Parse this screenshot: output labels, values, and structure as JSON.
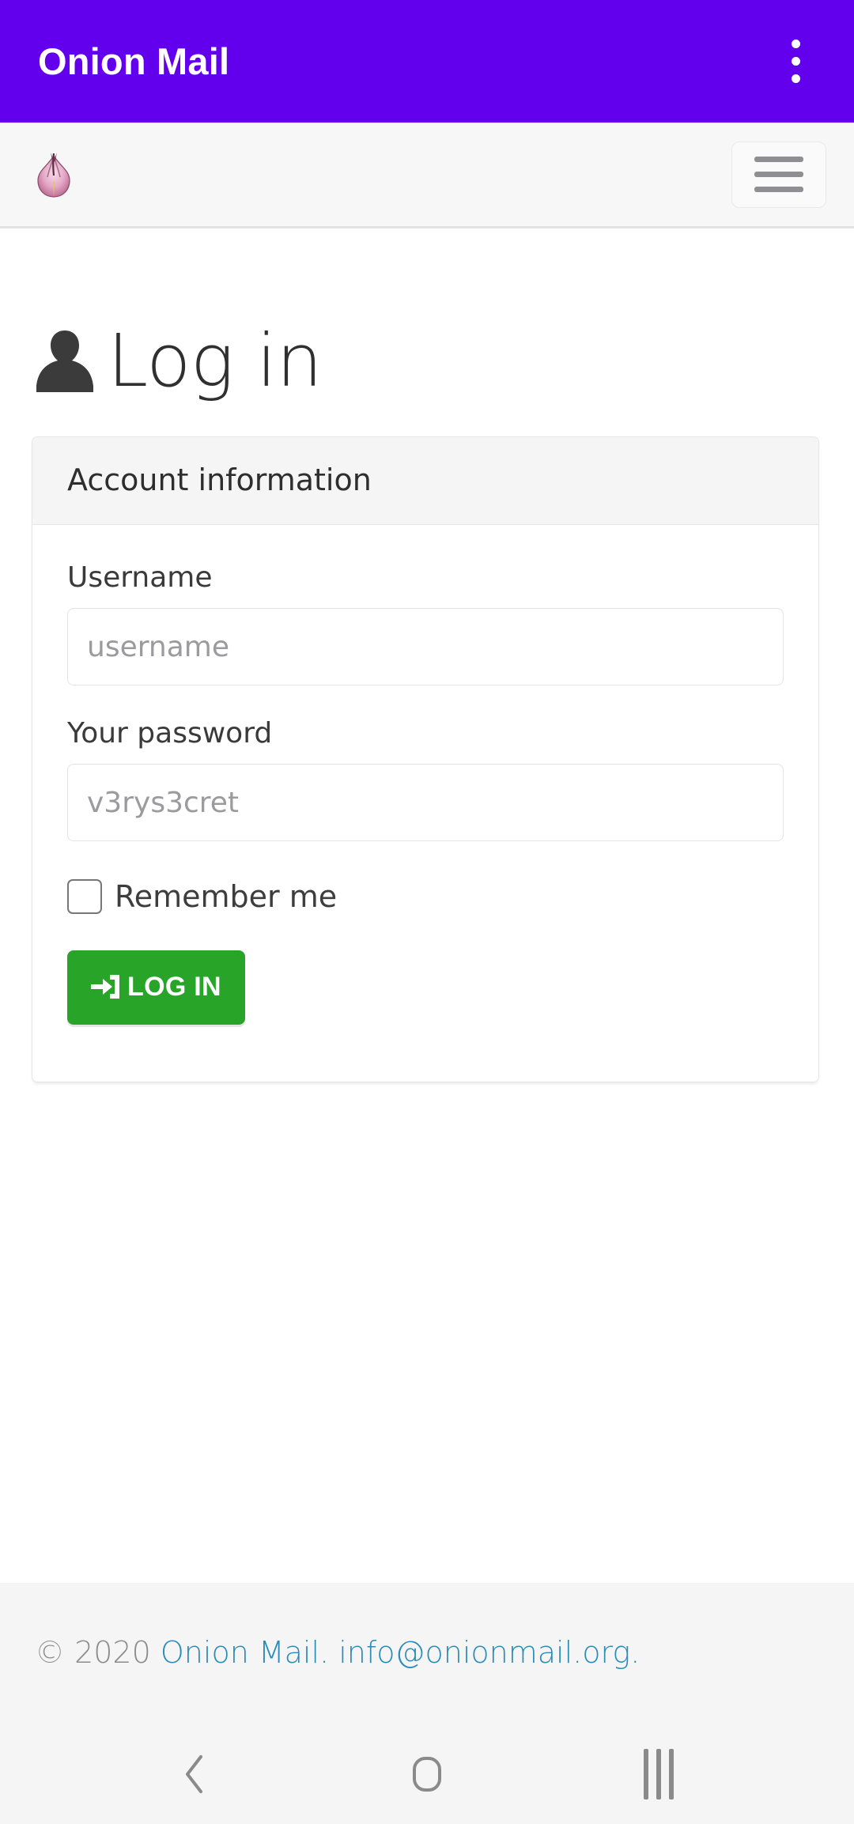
{
  "app_bar": {
    "title": "Onion Mail",
    "overflow_icon": "more-vertical-icon",
    "background_color": "#6200ee"
  },
  "site_nav": {
    "brand_icon": "onion-logo-icon",
    "menu_toggle_icon": "hamburger-icon"
  },
  "page": {
    "heading_icon": "user-silhouette-icon",
    "heading": "Log in"
  },
  "card": {
    "header": "Account information",
    "fields": [
      {
        "label": "Username",
        "placeholder": "username",
        "value": "",
        "name": "username-input"
      },
      {
        "label": "Your password",
        "placeholder": "v3rys3cret",
        "value": "",
        "name": "password-input"
      }
    ],
    "remember": {
      "label": "Remember me",
      "checked": false
    },
    "submit": {
      "label": "LOG IN",
      "icon": "sign-in-arrow-icon",
      "color": "#28a428"
    }
  },
  "footer": {
    "copyright": "© 2020",
    "brand_link": "Onion Mail.",
    "email_link": "info@onionmail.org.",
    "link_color": "#2a8cb8"
  },
  "android_nav": {
    "back": "back-chevron-icon",
    "home": "home-square-icon",
    "recents": "recents-bars-icon"
  }
}
